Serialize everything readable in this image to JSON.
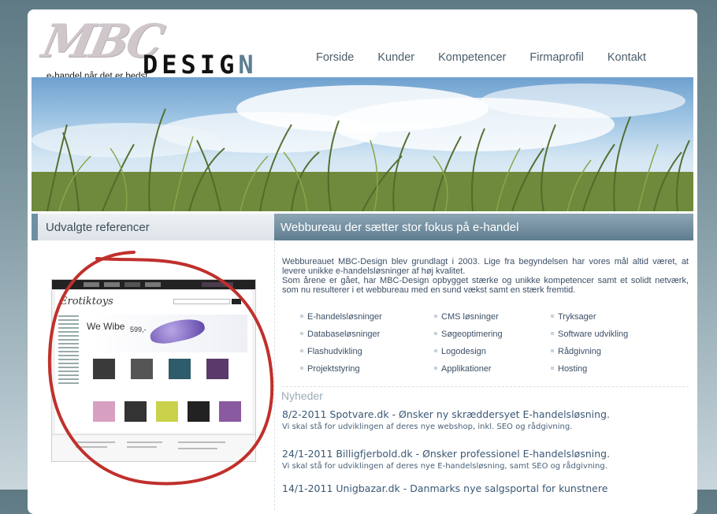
{
  "logo": {
    "mbc": "MBC",
    "design_prefix": "DESIG",
    "design_suffix": "N",
    "tagline": "e-handel når det er bedst"
  },
  "nav": {
    "items": [
      {
        "label": "Forside"
      },
      {
        "label": "Kunder"
      },
      {
        "label": "Kompetencer"
      },
      {
        "label": "Firmaprofil"
      },
      {
        "label": "Kontakt"
      }
    ]
  },
  "left": {
    "heading": "Udvalgte referencer",
    "reference": {
      "logo": "Erotiktoys",
      "feature_title": "We Wibe",
      "feature_price": "599,-"
    }
  },
  "right": {
    "heading": "Webbureau der sætter stor fokus på e-handel",
    "intro": [
      "Webbureauet MBC-Design blev grundlagt i 2003. Lige fra begyndelsen har vores mål altid været, at levere unikke e-handelsløsninger af høj kvalitet.",
      "Som årene er gået, har  MBC-Design opbygget stærke og unikke kompetencer samt et solidt netværk, som nu resulterer i et webbureau med en sund vækst samt en stærk fremtid."
    ],
    "services": [
      [
        "E-handelsløsninger",
        "CMS løsninger",
        "Tryksager"
      ],
      [
        "Databaseløsninger",
        "Søgeoptimering",
        "Software udvikling"
      ],
      [
        "Flashudvikling",
        "Logodesign",
        "Rådgivning"
      ],
      [
        "Projektstyring",
        "Applikationer",
        "Hosting"
      ]
    ],
    "news_heading": "Nyheder",
    "news": [
      {
        "headline": "8/2-2011 Spotvare.dk - Ønsker ny skræddersyet E-handelsløsning.",
        "text": "Vi skal stå for udviklingen af deres nye webshop, inkl. SEO og rådgivning."
      },
      {
        "headline": "24/1-2011 Billigfjerbold.dk - Ønsker professionel E-handelsløsning.",
        "text": "Vi skal stå for udviklingen af deres nye E-handelsløsning, samt SEO og rådgivning."
      },
      {
        "headline": "14/1-2011 Unigbazar.dk - Danmarks nye salgsportal for kunstnere",
        "text": ""
      }
    ]
  },
  "colors": {
    "accent": "#5f7d90",
    "link": "#3a5876",
    "annotation": "#c0302c"
  }
}
